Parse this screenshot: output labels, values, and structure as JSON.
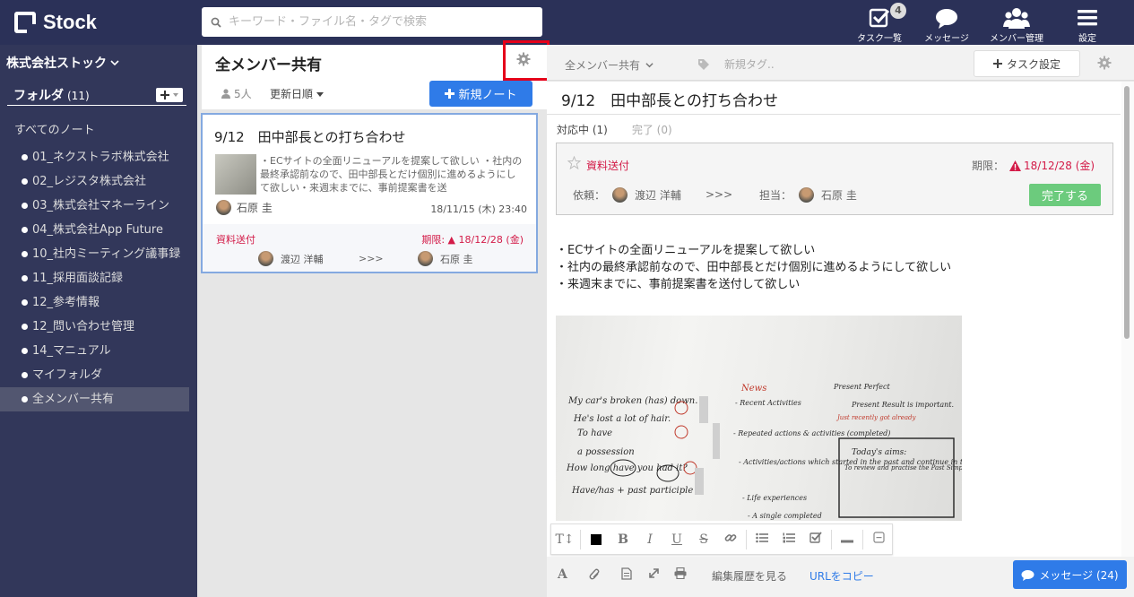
{
  "app": {
    "logo_text": "Stock"
  },
  "search": {
    "placeholder": "キーワード・ファイル名・タグで検索"
  },
  "nav": {
    "tasks_label": "タスク一覧",
    "tasks_badge": "4",
    "messages_label": "メッセージ",
    "members_label": "メンバー管理",
    "settings_label": "設定"
  },
  "sidebar": {
    "company": "株式会社ストック",
    "folder_label": "フォルダ",
    "folder_count": "(11)",
    "all_notes": "すべてのノート",
    "folders": [
      "01_ネクストラボ株式会社",
      "02_レジスタ株式会社",
      "03_株式会社マネーライン",
      "04_株式会社App Future",
      "10_社内ミーティング議事録",
      "11_採用面談記録",
      "12_参考情報",
      "12_問い合わせ管理",
      "14_マニュアル",
      "マイフォルダ",
      "全メンバー共有"
    ]
  },
  "middle": {
    "title": "全メンバー共有",
    "member_count": "5人",
    "sort_label": "更新日順",
    "new_note": "新規ノート"
  },
  "note": {
    "title": "9/12　田中部長との打ち合わせ",
    "snippet": "・ECサイトの全面リニューアルを提案して欲しい ・社内の最終承認前なので、田中部長とだけ個別に進めるようにして欲しい・来週末までに、事前提案書を送",
    "author": "石原 圭",
    "date": "18/11/15 (木) 23:40",
    "task_name": "資料送付",
    "task_due": "期限: ▲ 18/12/28 (金)",
    "task_from": "渡辺 洋輔",
    "task_arrow": ">>>",
    "task_to": "石原 圭"
  },
  "detail_header": {
    "share": "全メンバー共有",
    "tag_placeholder": "新規タグ..",
    "task_settings": "タスク設定"
  },
  "detail": {
    "title": "9/12　田中部長との打ち合わせ",
    "tab_active": "対応中 (1)",
    "tab_done": "完了 (0)",
    "task_name": "資料送付",
    "due_label": "期限：",
    "due_date": "18/12/28 (金)",
    "requester_label": "依頼：",
    "requester": "渡辺 洋輔",
    "arrow": ">>>",
    "assignee_label": "担当：",
    "assignee": "石原 圭",
    "complete_button": "完了する",
    "body_lines": [
      "・ECサイトの全面リニューアルを提案して欲しい",
      "・社内の最終承認前なので、田中部長とだけ個別に進めるようにして欲しい",
      "・来週末までに、事前提案書を送付して欲しい"
    ],
    "whiteboard_lines": [
      "My car's broken (has) down.",
      "He's lost a lot of hair.",
      "To have",
      "a possession",
      "How long have you had it?",
      "Have/has + past participle",
      "News",
      "- Recent Activities",
      "- Repeated actions & activities (completed)",
      "- Activities/actions which started in the past and continue in the present",
      "- Life experiences",
      "- A single completed",
      "Present Perfect",
      "Present Result is important.",
      "Just recently got already",
      "Today's aims:",
      "To review and practise the Past Simple and Present Perfect"
    ]
  },
  "bottom": {
    "history": "編集履歴を見る",
    "copy_url": "URLをコピー",
    "message_button": "メッセージ (24)"
  }
}
